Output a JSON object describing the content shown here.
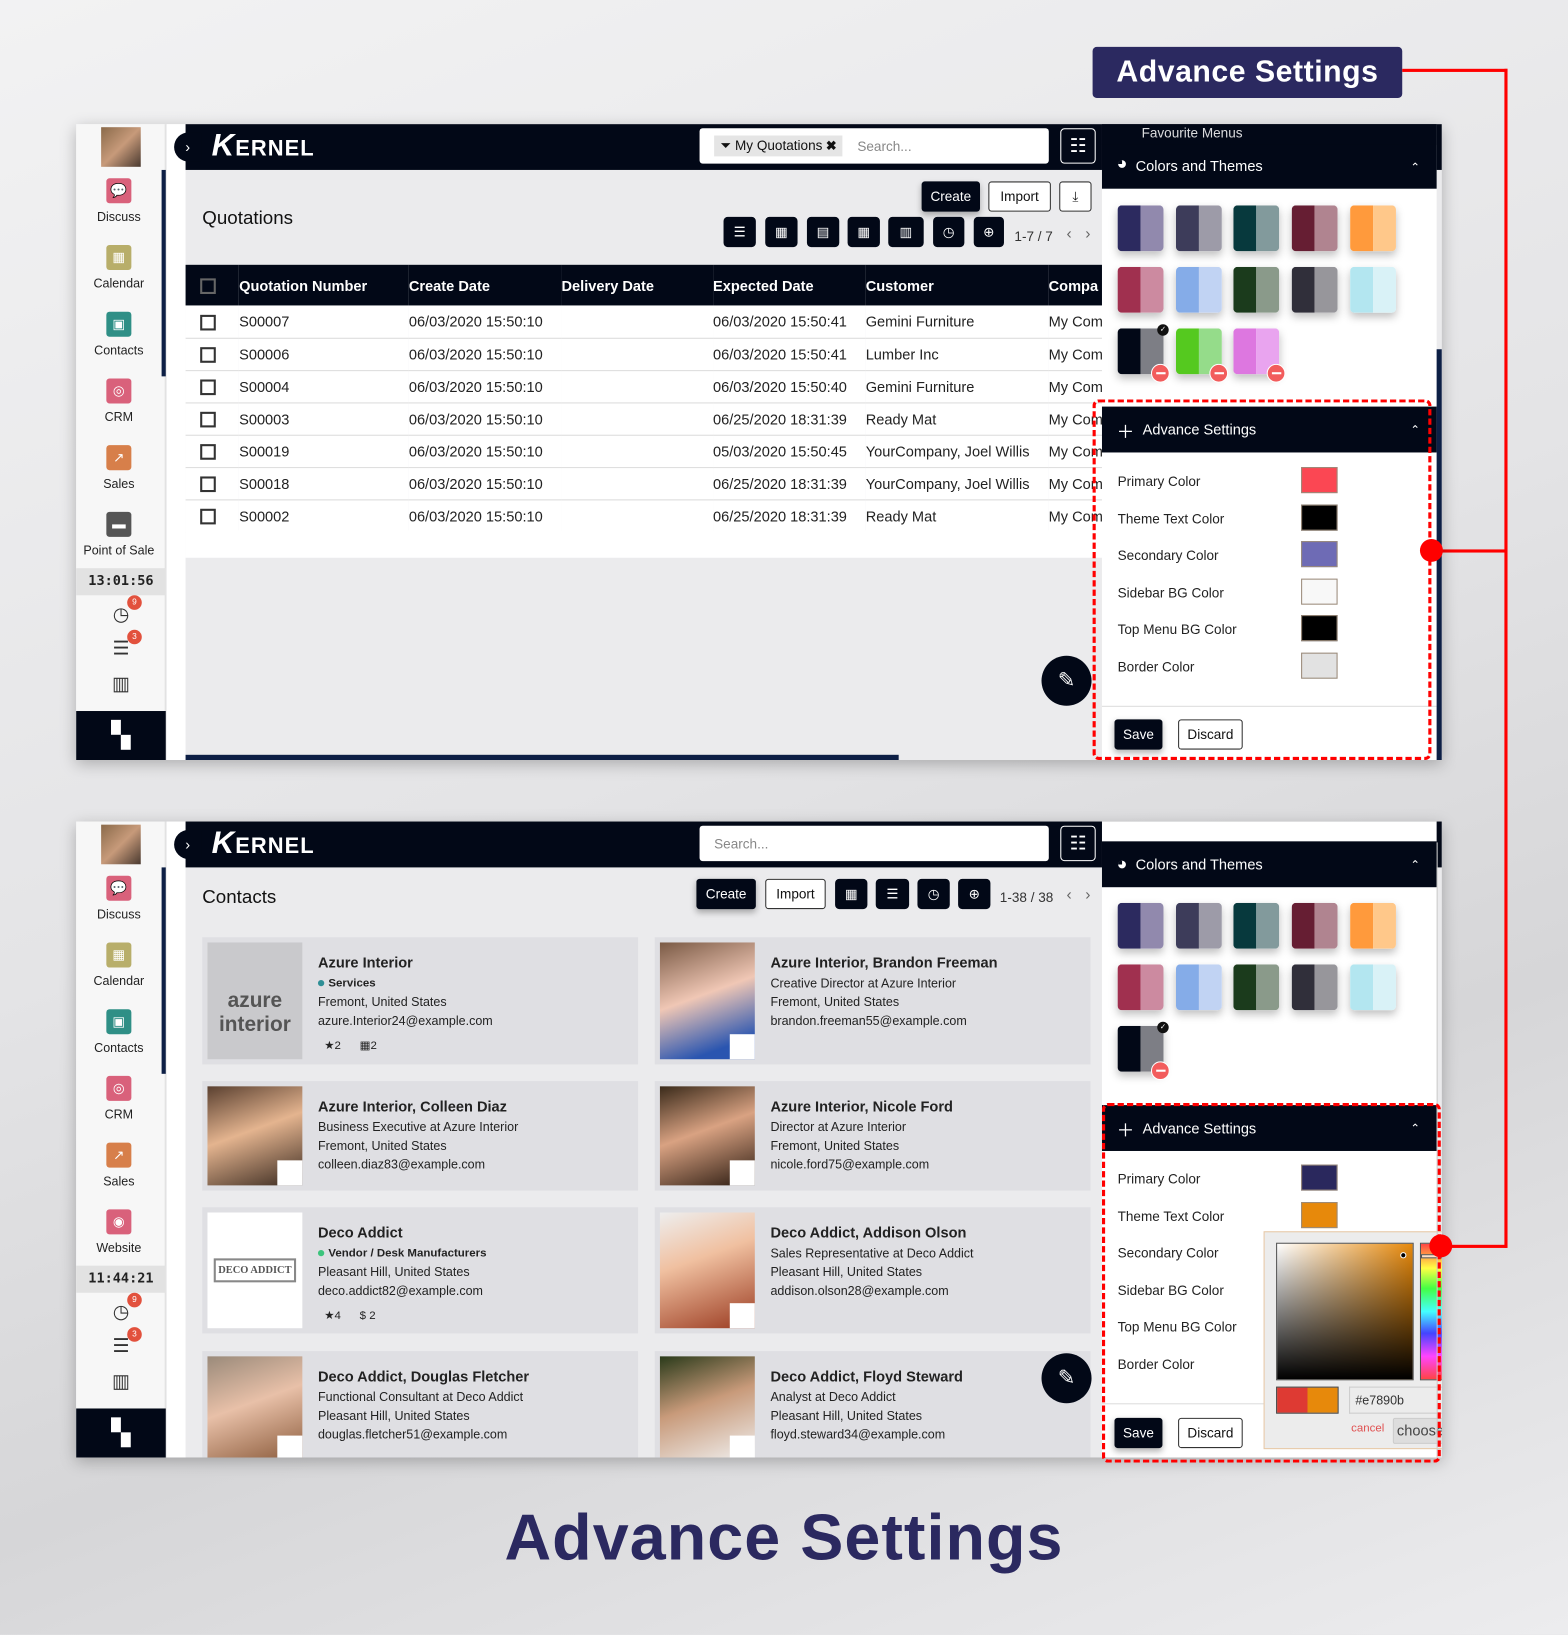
{
  "callout_title": "Advance Settings",
  "footer_title": "Advance Settings",
  "brand": {
    "logo_text": "ERNEL",
    "logo_initial": "K"
  },
  "accent_colors": {
    "navy": "#2b2960",
    "connector": "#ff0000",
    "topbar": "#020817"
  },
  "sidebar_top": {
    "items": [
      {
        "label": "Discuss",
        "icon": "chat-icon",
        "color": "#d9617b"
      },
      {
        "label": "Calendar",
        "icon": "calendar-icon",
        "color": "#b8ae6a"
      },
      {
        "label": "Contacts",
        "icon": "contacts-icon",
        "color": "#2f8f86"
      },
      {
        "label": "CRM",
        "icon": "lifebuoy-icon",
        "color": "#d9617b"
      },
      {
        "label": "Sales",
        "icon": "chart-icon",
        "color": "#d77f4a"
      },
      {
        "label": "Point of Sale",
        "icon": "store-icon",
        "color": "#555555"
      }
    ],
    "clock": "13:01:56",
    "activity_count": "9",
    "message_count": "3"
  },
  "sidebar_bottom": {
    "items": [
      {
        "label": "Discuss",
        "icon": "chat-icon",
        "color": "#d9617b"
      },
      {
        "label": "Calendar",
        "icon": "calendar-icon",
        "color": "#b8ae6a"
      },
      {
        "label": "Contacts",
        "icon": "contacts-icon",
        "color": "#2f8f86"
      },
      {
        "label": "CRM",
        "icon": "lifebuoy-icon",
        "color": "#d9617b"
      },
      {
        "label": "Sales",
        "icon": "chart-icon",
        "color": "#d77f4a"
      },
      {
        "label": "Website",
        "icon": "globe-icon",
        "color": "#d9617b"
      }
    ],
    "clock": "11:44:21",
    "activity_count": "9",
    "message_count": "3"
  },
  "quotations": {
    "title": "Quotations",
    "facet": "My Quotations",
    "search_placeholder": "Search...",
    "create": "Create",
    "import": "Import",
    "pager": "1-7 / 7",
    "columns": [
      "Quotation Number",
      "Create Date",
      "Delivery Date",
      "Expected Date",
      "Customer",
      "Compa"
    ],
    "rows": [
      [
        "S00007",
        "06/03/2020 15:50:10",
        "",
        "06/03/2020 15:50:41",
        "Gemini Furniture",
        "My Com"
      ],
      [
        "S00006",
        "06/03/2020 15:50:10",
        "",
        "06/03/2020 15:50:41",
        "Lumber Inc",
        "My Com"
      ],
      [
        "S00004",
        "06/03/2020 15:50:10",
        "",
        "06/03/2020 15:50:40",
        "Gemini Furniture",
        "My Com"
      ],
      [
        "S00003",
        "06/03/2020 15:50:10",
        "",
        "06/25/2020 18:31:39",
        "Ready Mat",
        "My Com"
      ],
      [
        "S00019",
        "06/03/2020 15:50:10",
        "",
        "05/03/2020 15:50:45",
        "YourCompany, Joel Willis",
        "My Com"
      ],
      [
        "S00018",
        "06/03/2020 15:50:10",
        "",
        "06/25/2020 18:31:39",
        "YourCompany, Joel Willis",
        "My Com"
      ],
      [
        "S00002",
        "06/03/2020 15:50:10",
        "",
        "06/25/2020 18:31:39",
        "Ready Mat",
        "My Com"
      ]
    ]
  },
  "contacts": {
    "title": "Contacts",
    "search_placeholder": "Search...",
    "create": "Create",
    "import": "Import",
    "pager": "1-38 / 38",
    "cards": [
      {
        "name": "Azure Interior",
        "tag": "Services",
        "tag_color": "#2f8f96",
        "lines": [
          "Fremont, United States",
          "azure.Interior24@example.com"
        ],
        "meta": [
          "★2",
          "▦2"
        ],
        "logo": "azure interior"
      },
      {
        "name": "Azure Interior, Brandon Freeman",
        "lines": [
          "Creative Director at Azure Interior",
          "Fremont, United States",
          "brandon.freeman55@example.com"
        ]
      },
      {
        "name": "Azure Interior, Colleen Diaz",
        "lines": [
          "Business Executive at Azure Interior",
          "Fremont, United States",
          "colleen.diaz83@example.com"
        ]
      },
      {
        "name": "Azure Interior, Nicole Ford",
        "lines": [
          "Director at Azure Interior",
          "Fremont, United States",
          "nicole.ford75@example.com"
        ]
      },
      {
        "name": "Deco Addict",
        "tag": "Vendor / Desk Manufacturers",
        "tag_color": "#3cc47c",
        "lines": [
          "Pleasant Hill, United States",
          "deco.addict82@example.com"
        ],
        "meta": [
          "★4",
          "$ 2"
        ],
        "logo": "DECO ADDICT"
      },
      {
        "name": "Deco Addict, Addison Olson",
        "lines": [
          "Sales Representative at Deco Addict",
          "Pleasant Hill, United States",
          "addison.olson28@example.com"
        ]
      },
      {
        "name": "Deco Addict, Douglas Fletcher",
        "lines": [
          "Functional Consultant at Deco Addict",
          "Pleasant Hill, United States",
          "douglas.fletcher51@example.com"
        ]
      },
      {
        "name": "Deco Addict, Floyd Steward",
        "lines": [
          "Analyst at Deco Addict",
          "Pleasant Hill, United States",
          "floyd.steward34@example.com"
        ]
      }
    ]
  },
  "panel": {
    "favourite_menus": "Favourite Menus",
    "colors_and_themes": "Colors and Themes",
    "advance_settings": "Advance Settings",
    "themes": [
      [
        "#2c2a5f",
        "#9189ad"
      ],
      [
        "#3d3c5a",
        "#9d9ba8"
      ],
      [
        "#07393d",
        "#829a9c"
      ],
      [
        "#661e33",
        "#b08490"
      ],
      [
        "#ff9a3c",
        "#ffc88a"
      ],
      [
        "#a0304f",
        "#cc8aa0"
      ],
      [
        "#85ace8",
        "#c1d3f3"
      ],
      [
        "#1b3b1c",
        "#8a9a8a"
      ],
      [
        "#302f3a",
        "#97969b"
      ],
      [
        "#b3e6f0",
        "#d9f2f7"
      ],
      [
        "#020817",
        "#7d7e85"
      ],
      [
        "#55c91f",
        "#95dc8a"
      ],
      [
        "#dd77e0",
        "#e9a4ef"
      ]
    ],
    "settings_top": [
      {
        "label": "Primary Color",
        "value": "#fb4753"
      },
      {
        "label": "Theme Text Color",
        "value": "#000000"
      },
      {
        "label": "Secondary Color",
        "value": "#6e6bb5"
      },
      {
        "label": "Sidebar BG Color",
        "value": "#f8f8f8"
      },
      {
        "label": "Top Menu BG Color",
        "value": "#000000"
      },
      {
        "label": "Border Color",
        "value": "#e2e2e2"
      }
    ],
    "settings_bottom": [
      {
        "label": "Primary Color",
        "value": "#2a285d"
      },
      {
        "label": "Theme Text Color",
        "value": "#e7890b"
      },
      {
        "label": "Secondary Color",
        "value": ""
      },
      {
        "label": "Sidebar BG Color",
        "value": ""
      },
      {
        "label": "Top Menu BG Color",
        "value": ""
      },
      {
        "label": "Border Color",
        "value": ""
      }
    ],
    "save": "Save",
    "discard": "Discard",
    "picker": {
      "hex": "#e7890b",
      "cancel": "cancel",
      "choose": "choose",
      "previous": "#de3a33"
    }
  }
}
